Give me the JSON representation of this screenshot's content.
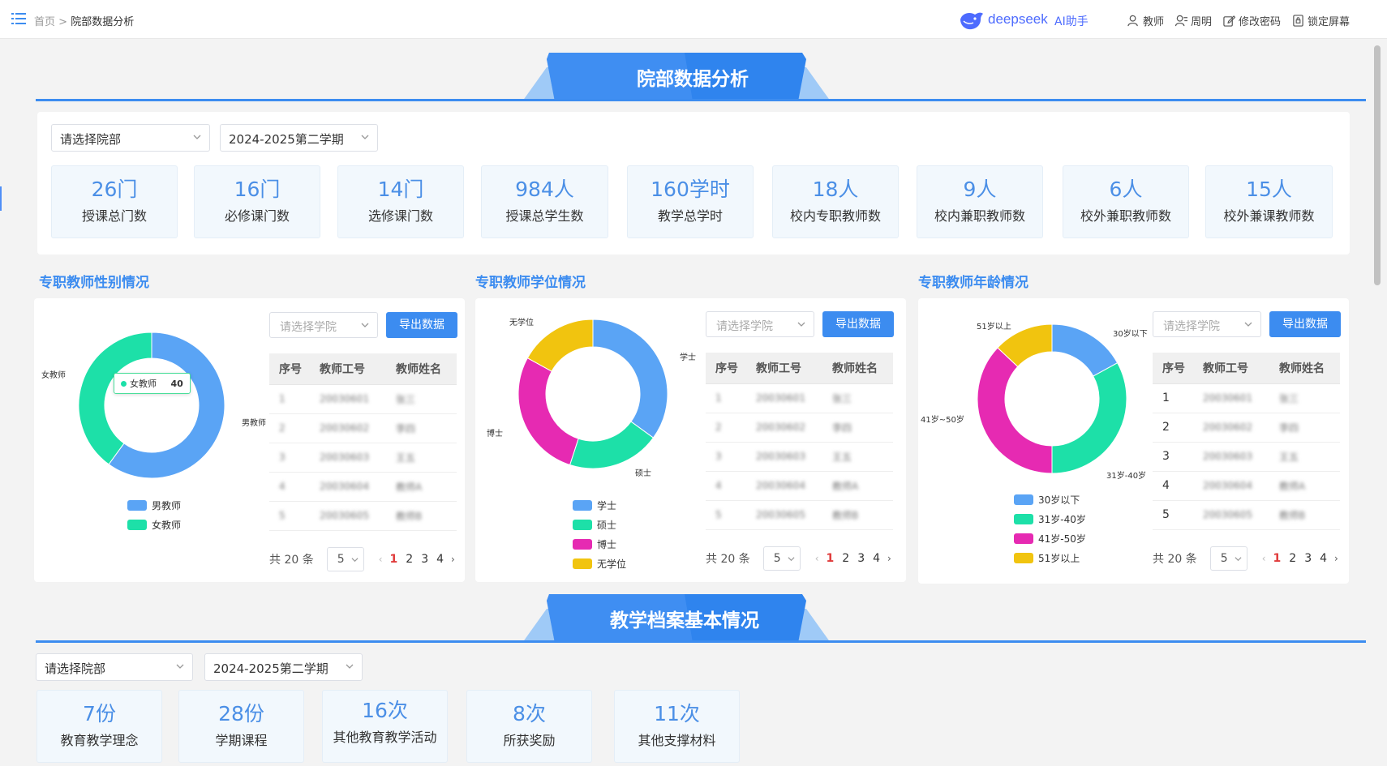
{
  "topbar": {
    "breadcrumb_home": "首页",
    "breadcrumb_sep": ">",
    "breadcrumb_current": "院部数据分析",
    "brand_text": "deepseek",
    "brand_ai": "AI助手",
    "user_role": "教师",
    "user_name": "周明",
    "change_password": "修改密码",
    "lock_screen": "锁定屏幕"
  },
  "section1": {
    "title": "院部数据分析",
    "dept_select": "请选择院部",
    "term_select": "2024-2025第二学期",
    "stats": [
      {
        "value": "26门",
        "label": "授课总门数"
      },
      {
        "value": "16门",
        "label": "必修课门数"
      },
      {
        "value": "14门",
        "label": "选修课门数"
      },
      {
        "value": "984人",
        "label": "授课总学生数"
      },
      {
        "value": "160学时",
        "label": "教学总学时"
      },
      {
        "value": "18人",
        "label": "校内专职教师数"
      },
      {
        "value": "9人",
        "label": "校内兼职教师数"
      },
      {
        "value": "6人",
        "label": "校外兼职教师数"
      },
      {
        "value": "15人",
        "label": "校外兼课教师数"
      }
    ]
  },
  "charts_common": {
    "college_placeholder": "请选择学院",
    "export_label": "导出数据",
    "col_index": "序号",
    "col_id": "教师工号",
    "col_name": "教师姓名",
    "total_label": "共 20 条",
    "page_size": "5",
    "pages": [
      "1",
      "2",
      "3",
      "4"
    ],
    "prev": "‹",
    "next": "›"
  },
  "table_rows": [
    {
      "idx": "1",
      "id": "20030601",
      "name": "张三"
    },
    {
      "idx": "2",
      "id": "20030602",
      "name": "李四"
    },
    {
      "idx": "3",
      "id": "20030603",
      "name": "王五"
    },
    {
      "idx": "4",
      "id": "20030604",
      "name": "教师A"
    },
    {
      "idx": "5",
      "id": "20030605",
      "name": "教师B"
    }
  ],
  "chart_data": [
    {
      "type": "pie",
      "title": "专职教师性别情况",
      "categories": [
        "男教师",
        "女教师"
      ],
      "values": [
        60,
        40
      ],
      "colors": [
        "#5aa4f5",
        "#1de0a8"
      ],
      "tooltip": {
        "label": "女教师",
        "value": "40"
      }
    },
    {
      "type": "pie",
      "title": "专职教师学位情况",
      "categories": [
        "学士",
        "硕士",
        "博士",
        "无学位"
      ],
      "values": [
        35,
        20,
        28,
        17
      ],
      "colors": [
        "#5aa4f5",
        "#1de0a8",
        "#e62ab2",
        "#f1c40f"
      ]
    },
    {
      "type": "pie",
      "title": "专职教师年龄情况",
      "categories": [
        "30岁以下",
        "31岁-40岁",
        "41岁~50岁",
        "51岁以上"
      ],
      "legend_labels": [
        "30岁以下",
        "31岁-40岁",
        "41岁-50岁",
        "51岁以上"
      ],
      "values": [
        17,
        33,
        37,
        13
      ],
      "colors": [
        "#5aa4f5",
        "#1de0a8",
        "#e62ab2",
        "#f1c40f"
      ]
    }
  ],
  "section2": {
    "title": "教学档案基本情况",
    "dept_select": "请选择院部",
    "term_select": "2024-2025第二学期",
    "stats": [
      {
        "value": "7份",
        "label": "教育教学理念"
      },
      {
        "value": "28份",
        "label": "学期课程"
      },
      {
        "value": "16次",
        "label": "其他教育教学活动"
      },
      {
        "value": "8次",
        "label": "所获奖励"
      },
      {
        "value": "11次",
        "label": "其他支撑材料"
      }
    ]
  }
}
